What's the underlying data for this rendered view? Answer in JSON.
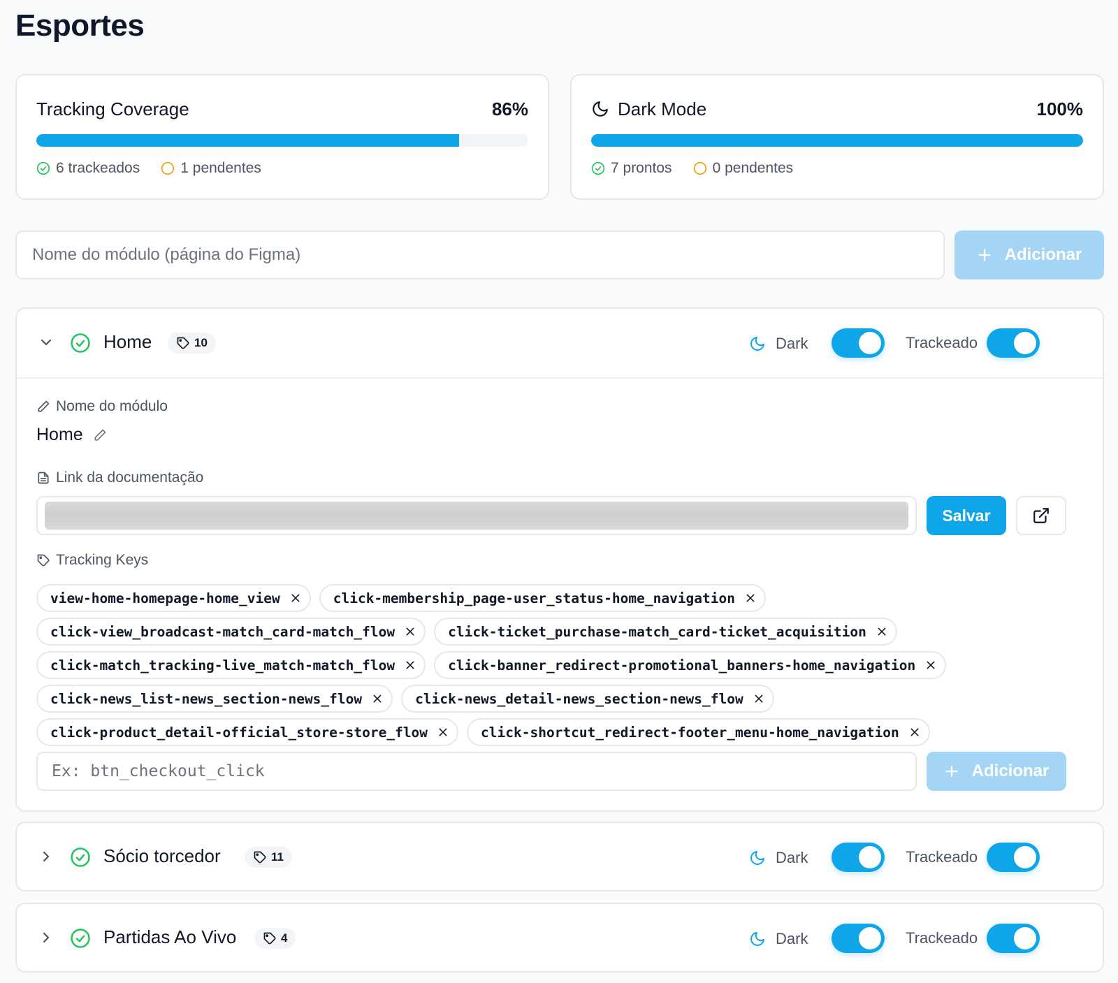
{
  "page": {
    "title": "Esportes"
  },
  "stats": {
    "tracking": {
      "title": "Tracking Coverage",
      "percent_label": "86%",
      "percent": 86,
      "done_label": "6 trackeados",
      "pending_label": "1 pendentes"
    },
    "dark": {
      "title": "Dark Mode",
      "percent_label": "100%",
      "percent": 100,
      "done_label": "7 prontos",
      "pending_label": "0 pendentes"
    }
  },
  "add_module": {
    "placeholder": "Nome do módulo (página do Figma)",
    "button_label": "Adicionar"
  },
  "toggle_labels": {
    "dark": "Dark",
    "tracked": "Trackeado"
  },
  "modules": [
    {
      "name": "Home",
      "key_count": "10",
      "expanded": true,
      "dark_on": true,
      "tracked_on": true,
      "name_section_label": "Nome do módulo",
      "doc_section_label": "Link da documentação",
      "save_label": "Salvar",
      "keys_section_label": "Tracking Keys",
      "keys": [
        "view-home-homepage-home_view",
        "click-membership_page-user_status-home_navigation",
        "click-view_broadcast-match_card-match_flow",
        "click-ticket_purchase-match_card-ticket_acquisition",
        "click-match_tracking-live_match-match_flow",
        "click-banner_redirect-promotional_banners-home_navigation",
        "click-news_list-news_section-news_flow",
        "click-news_detail-news_section-news_flow",
        "click-product_detail-official_store-store_flow",
        "click-shortcut_redirect-footer_menu-home_navigation"
      ],
      "key_input_placeholder": "Ex: btn_checkout_click",
      "add_key_label": "Adicionar"
    },
    {
      "name": "Sócio torcedor",
      "key_count": "11",
      "expanded": false,
      "dark_on": true,
      "tracked_on": true
    },
    {
      "name": "Partidas Ao Vivo",
      "key_count": "4",
      "expanded": false,
      "dark_on": true,
      "tracked_on": true
    }
  ],
  "colors": {
    "accent": "#0ea5e9",
    "accent_disabled": "#a5d5f4",
    "success": "#22c55e",
    "warning": "#f59e0b"
  },
  "icons": [
    "moon-icon",
    "check-circle-icon",
    "pending-circle-icon",
    "plus-icon",
    "chevron-down-icon",
    "chevron-right-icon",
    "tag-icon",
    "pencil-icon",
    "document-icon",
    "external-link-icon",
    "close-icon"
  ]
}
